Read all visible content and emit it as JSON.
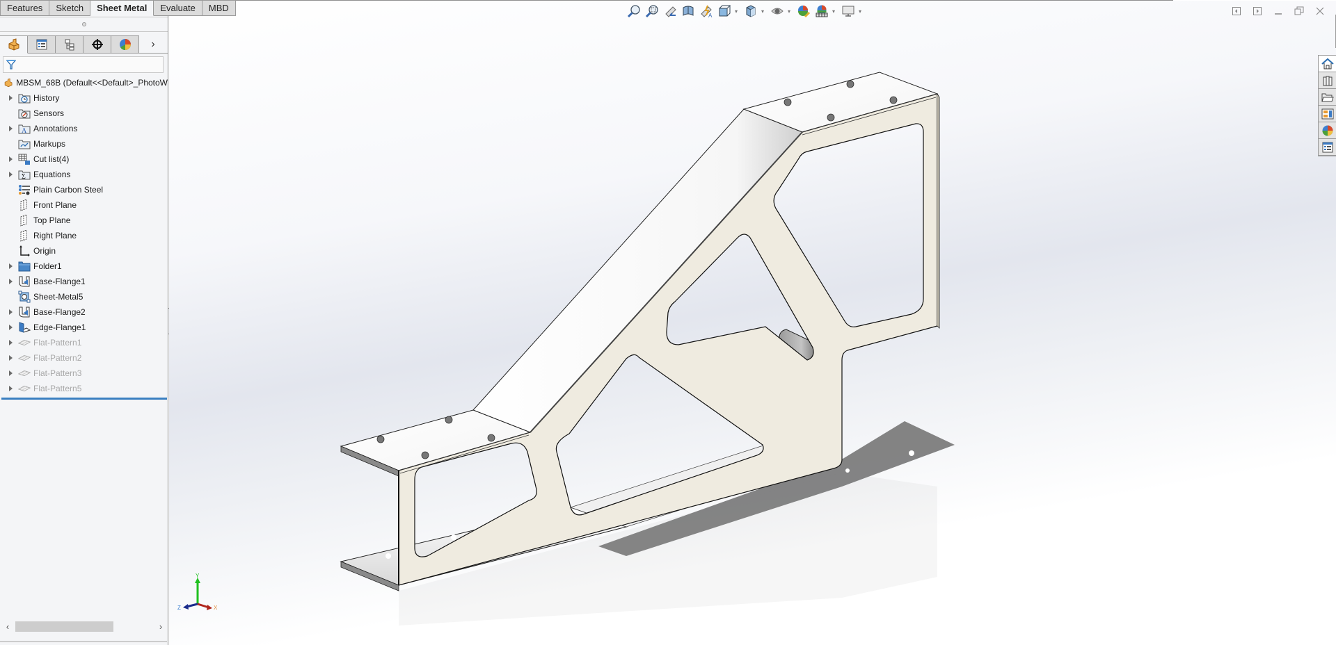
{
  "command_tabs": [
    {
      "label": "Features",
      "active": false
    },
    {
      "label": "Sketch",
      "active": false
    },
    {
      "label": "Sheet Metal",
      "active": true
    },
    {
      "label": "Evaluate",
      "active": false
    },
    {
      "label": "MBD",
      "active": false
    }
  ],
  "manager_tabs": [
    {
      "icon": "feature-manager-icon"
    },
    {
      "icon": "property-manager-icon"
    },
    {
      "icon": "configuration-manager-icon"
    },
    {
      "icon": "dimxpert-manager-icon"
    },
    {
      "icon": "display-manager-icon"
    }
  ],
  "manager_more": "›",
  "tree": {
    "root_label": "MBSM_68B  (Default<<Default>_PhotoW",
    "items": [
      {
        "label": "History",
        "icon": "history-folder-icon",
        "expandable": true,
        "suppressed": false
      },
      {
        "label": "Sensors",
        "icon": "sensors-folder-icon",
        "expandable": false,
        "suppressed": false
      },
      {
        "label": "Annotations",
        "icon": "annotations-folder-icon",
        "expandable": true,
        "suppressed": false
      },
      {
        "label": "Markups",
        "icon": "markups-folder-icon",
        "expandable": false,
        "suppressed": false
      },
      {
        "label": "Cut list(4)",
        "icon": "cut-list-icon",
        "expandable": true,
        "suppressed": false
      },
      {
        "label": "Equations",
        "icon": "equations-folder-icon",
        "expandable": true,
        "suppressed": false
      },
      {
        "label": "Plain Carbon Steel",
        "icon": "material-icon",
        "expandable": false,
        "suppressed": false
      },
      {
        "label": "Front Plane",
        "icon": "plane-icon",
        "expandable": false,
        "suppressed": false
      },
      {
        "label": "Top Plane",
        "icon": "plane-icon",
        "expandable": false,
        "suppressed": false
      },
      {
        "label": "Right Plane",
        "icon": "plane-icon",
        "expandable": false,
        "suppressed": false
      },
      {
        "label": "Origin",
        "icon": "origin-icon",
        "expandable": false,
        "suppressed": false
      },
      {
        "label": "Folder1",
        "icon": "folder-icon",
        "expandable": true,
        "suppressed": false
      },
      {
        "label": "Base-Flange1",
        "icon": "base-flange-icon",
        "expandable": true,
        "suppressed": false
      },
      {
        "label": "Sheet-Metal5",
        "icon": "sheet-metal-icon",
        "expandable": false,
        "suppressed": false
      },
      {
        "label": "Base-Flange2",
        "icon": "base-flange-icon",
        "expandable": true,
        "suppressed": false
      },
      {
        "label": "Edge-Flange1",
        "icon": "edge-flange-icon",
        "expandable": true,
        "suppressed": false
      },
      {
        "label": "Flat-Pattern1",
        "icon": "flat-pattern-icon",
        "expandable": true,
        "suppressed": true
      },
      {
        "label": "Flat-Pattern2",
        "icon": "flat-pattern-icon",
        "expandable": true,
        "suppressed": true
      },
      {
        "label": "Flat-Pattern3",
        "icon": "flat-pattern-icon",
        "expandable": true,
        "suppressed": true
      },
      {
        "label": "Flat-Pattern5",
        "icon": "flat-pattern-icon",
        "expandable": true,
        "suppressed": true
      }
    ]
  },
  "scroll": {
    "left": "‹",
    "right": "›"
  },
  "heads_up_toolbar": [
    {
      "name": "zoom-to-fit",
      "dropdown": false
    },
    {
      "name": "zoom-to-area",
      "dropdown": false
    },
    {
      "name": "previous-view",
      "dropdown": false
    },
    {
      "name": "section-view",
      "dropdown": false
    },
    {
      "name": "dynamic-annotation-views",
      "dropdown": false
    },
    {
      "name": "view-orientation",
      "dropdown": true
    },
    {
      "name": "display-style",
      "dropdown": true
    },
    {
      "name": "hide-show-items",
      "dropdown": true
    },
    {
      "name": "edit-appearance",
      "dropdown": false
    },
    {
      "name": "apply-scene",
      "dropdown": true
    },
    {
      "name": "view-settings",
      "dropdown": true
    }
  ],
  "window_controls": [
    "tile-left",
    "tile-right",
    "minimize",
    "restore",
    "close"
  ],
  "task_pane": [
    "home",
    "design-library",
    "file-explorer",
    "view-palette",
    "appearances",
    "custom-properties"
  ],
  "triad": {
    "x": "X",
    "y": "Y",
    "z": "Z"
  },
  "colors": {
    "sheet_face": "#efebe0",
    "flange_face": "#ffffff",
    "triad_x": "#b0261c",
    "triad_y": "#20c020",
    "triad_z": "#1a2c8c",
    "selection_line": "#3a7fc1"
  }
}
